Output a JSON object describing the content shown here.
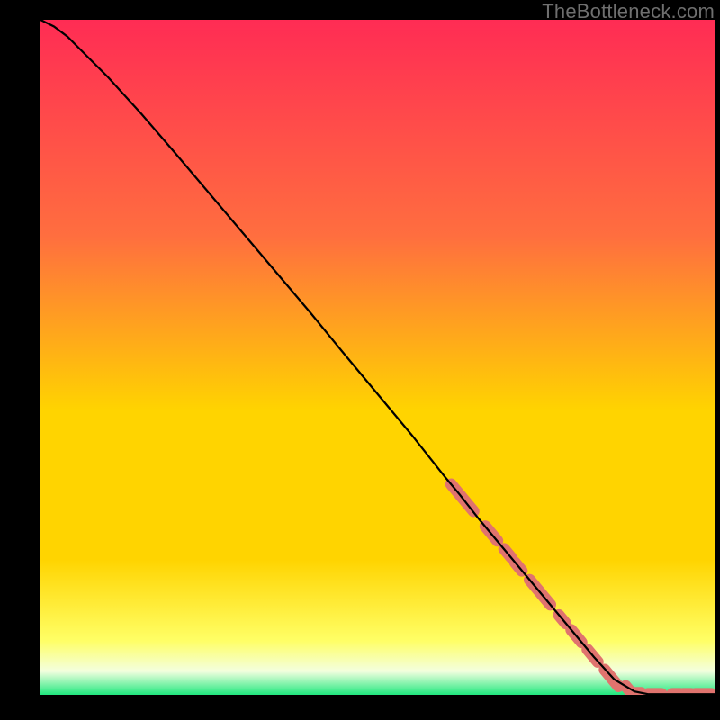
{
  "watermark": "TheBottleneck.com",
  "colors": {
    "grad_top": "#ff2c54",
    "grad_upper_mid": "#ff6e3f",
    "grad_mid": "#ffd400",
    "grad_low": "#ffff66",
    "grad_pale": "#f3ffdf",
    "grad_green": "#20e87e",
    "line": "#000000",
    "marker": "#e0736e",
    "bg": "#000000"
  },
  "chart_data": {
    "type": "line",
    "title": "",
    "xlabel": "",
    "ylabel": "",
    "xlim": [
      0,
      100
    ],
    "ylim": [
      0,
      100
    ],
    "line": {
      "x": [
        0,
        2,
        4,
        6,
        8,
        10,
        15,
        20,
        25,
        30,
        35,
        40,
        45,
        50,
        55,
        60,
        62,
        65,
        68,
        70,
        72,
        75,
        78,
        80,
        82,
        85,
        88,
        90,
        91,
        92,
        93.5,
        95,
        97,
        100
      ],
      "y": [
        100,
        99,
        97.5,
        95.5,
        93.5,
        91.5,
        86,
        80.2,
        74.3,
        68.4,
        62.5,
        56.6,
        50.5,
        44.5,
        38.5,
        32.2,
        29.8,
        26,
        22.4,
        20,
        17.6,
        14,
        10.4,
        8,
        5.6,
        2.3,
        0.5,
        0.1,
        0.1,
        0.1,
        0.1,
        0.1,
        0.1,
        0.1
      ]
    },
    "markers": [
      {
        "x": 62.5,
        "y": 29.2,
        "len": 5.2
      },
      {
        "x": 66.8,
        "y": 23.9,
        "len": 2.8
      },
      {
        "x": 69.2,
        "y": 21.0,
        "len": 1.6
      },
      {
        "x": 70.8,
        "y": 19.0,
        "len": 1.6
      },
      {
        "x": 74.0,
        "y": 15.2,
        "len": 4.8
      },
      {
        "x": 77.3,
        "y": 11.2,
        "len": 1.6
      },
      {
        "x": 79.4,
        "y": 8.7,
        "len": 2.4
      },
      {
        "x": 81.8,
        "y": 5.8,
        "len": 2.4
      },
      {
        "x": 84.6,
        "y": 2.5,
        "len": 3.2
      },
      {
        "x": 87.2,
        "y": 0.7,
        "len": 1.6
      },
      {
        "x": 88.4,
        "y": 0.3,
        "len_h": 1.2
      },
      {
        "x": 91.0,
        "y": 0.15,
        "len_h": 2.0
      },
      {
        "x": 94.2,
        "y": 0.15,
        "len_h": 1.2
      },
      {
        "x": 95.8,
        "y": 0.15,
        "len_h": 1.2
      },
      {
        "x": 98.2,
        "y": 0.15,
        "len_h": 2.4
      }
    ]
  }
}
